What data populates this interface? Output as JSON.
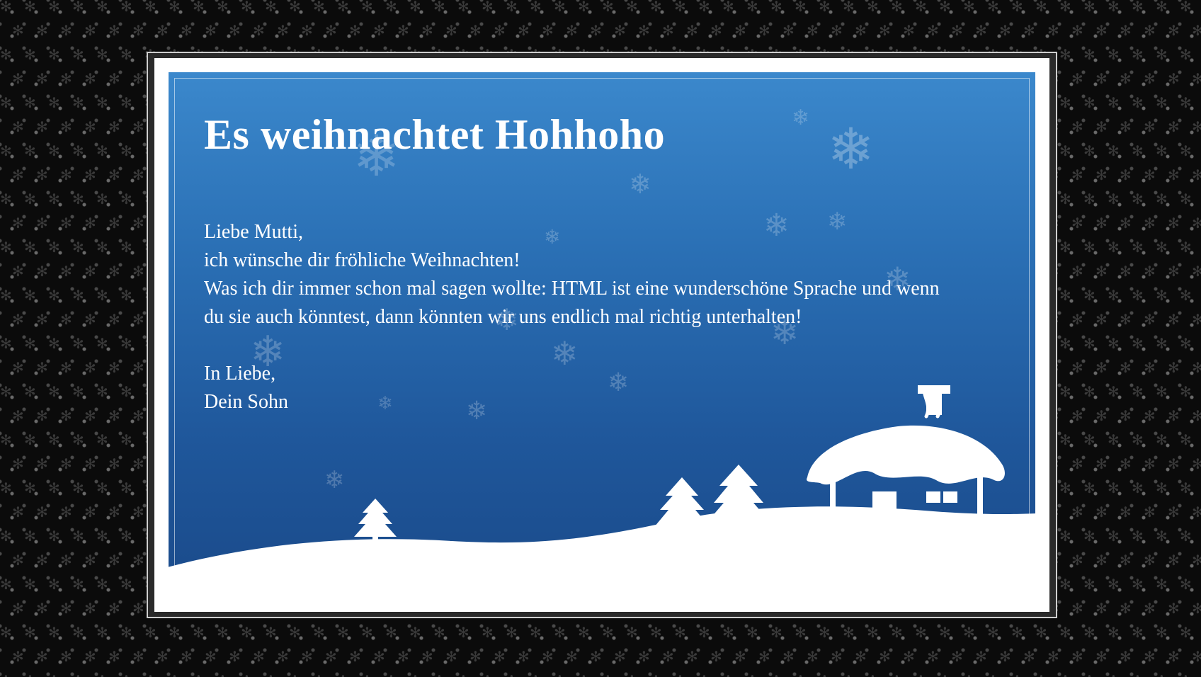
{
  "card": {
    "title": "Es weihnachtet Hohhoho",
    "greeting": "Liebe Mutti,",
    "wish": "ich wünsche dir fröhliche Weihnachten!",
    "message": "Was ich dir immer schon mal sagen wollte: HTML ist eine wunderschöne Sprache und wenn du sie auch könntest, dann könnten wir uns endlich mal richtig unterhalten!",
    "closing": "In Liebe,",
    "signature": "Dein Sohn"
  },
  "colors": {
    "card_blue_top": "#3b88cc",
    "card_blue_bottom": "#1a4a8a",
    "snow": "#ffffff",
    "background": "#0b0b0b"
  },
  "icons": {
    "background_pattern": "snowflake-icon",
    "scene": "snow-house-icon",
    "trees": "pine-tree-icon"
  }
}
